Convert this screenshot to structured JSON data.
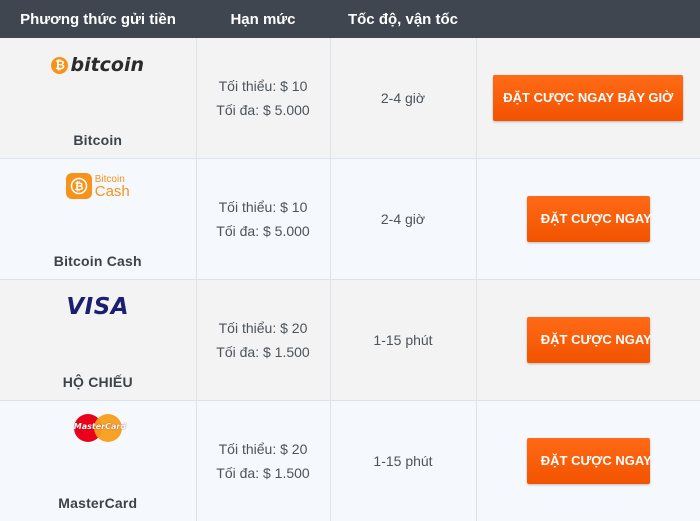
{
  "table": {
    "headers": [
      "Phương thức gửi tiền",
      "Hạn mức",
      "Tốc độ, vận tốc",
      ""
    ],
    "rows": [
      {
        "logo_icon": "bitcoin-logo-icon",
        "logo_text": "bitcoin",
        "name": "Bitcoin",
        "min": "Tối thiểu: $ 10",
        "max": "Tối đa: $ 5.000",
        "speed": "2-4 giờ",
        "button": "ĐẶT CƯỢC NGAY BÂY GIỜ"
      },
      {
        "logo_icon": "bitcoin-cash-logo-icon",
        "logo_text_1": "Bitcoin",
        "logo_text_2": "Cash",
        "name": "Bitcoin Cash",
        "min": "Tối thiểu: $ 10",
        "max": "Tối đa: $ 5.000",
        "speed": "2-4 giờ",
        "button": "ĐẶT CƯỢC NGAY"
      },
      {
        "logo_icon": "visa-logo-icon",
        "logo_text": "VISA",
        "name": "HỘ CHIẾU",
        "min": "Tối thiểu: $ 20",
        "max": "Tối đa: $ 1.500",
        "speed": "1-15 phút",
        "button": "ĐẶT CƯỢC NGAY"
      },
      {
        "logo_icon": "mastercard-logo-icon",
        "logo_text": "MasterCard",
        "name": "MasterCard",
        "min": "Tối thiểu: $ 20",
        "max": "Tối đa: $ 1.500",
        "speed": "1-15 phút",
        "button": "ĐẶT CƯỢC NGAY"
      }
    ]
  },
  "colors": {
    "header_bg": "#3f4650",
    "button_bg": "#f25300",
    "bitcoin_orange": "#f7931a",
    "visa_blue": "#1a1f71"
  }
}
